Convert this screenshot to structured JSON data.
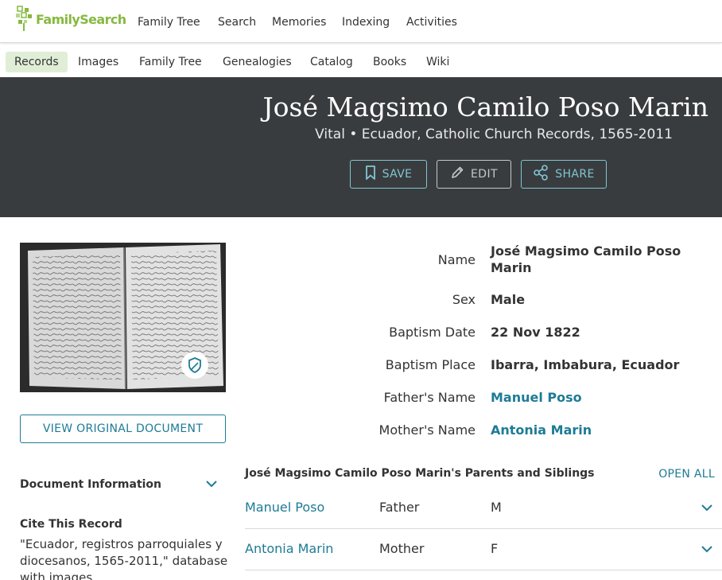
{
  "brand": {
    "name": "FamilySearch",
    "accent": "#87b940",
    "link_color": "#1e7b96"
  },
  "topnav": [
    "Family Tree",
    "Search",
    "Memories",
    "Indexing",
    "Activities"
  ],
  "subnav": {
    "active": "Records",
    "items": [
      "Records",
      "Images",
      "Family Tree",
      "Genealogies",
      "Catalog",
      "Books",
      "Wiki"
    ]
  },
  "banner": {
    "title": "José Magsimo Camilo Poso Marin",
    "subtitle": "Vital • Ecuador, Catholic Church Records, 1565-2011",
    "buttons": {
      "save": "SAVE",
      "edit": "EDIT",
      "share": "SHARE"
    }
  },
  "left": {
    "view_button": "VIEW ORIGINAL DOCUMENT",
    "document_info": "Document Information",
    "cite_title": "Cite This Record",
    "cite_text": "\"Ecuador, registros parroquiales y diocesanos, 1565-2011,\" database with images"
  },
  "facts": [
    {
      "label": "Name",
      "value": "José Magsimo Camilo Poso Marin",
      "link": false
    },
    {
      "label": "Sex",
      "value": "Male",
      "link": false
    },
    {
      "label": "Baptism Date",
      "value": "22 Nov 1822",
      "link": false
    },
    {
      "label": "Baptism Place",
      "value": "Ibarra, Imbabura, Ecuador",
      "link": false
    },
    {
      "label": "Father's Name",
      "value": "Manuel Poso",
      "link": true
    },
    {
      "label": "Mother's Name",
      "value": "Antonia Marin",
      "link": true
    }
  ],
  "parents_siblings": {
    "heading": "José Magsimo Camilo Poso Marin's Parents and Siblings",
    "open_all": "OPEN ALL",
    "rows": [
      {
        "name": "Manuel Poso",
        "relationship": "Father",
        "sex": "M"
      },
      {
        "name": "Antonia Marin",
        "relationship": "Mother",
        "sex": "F"
      }
    ]
  }
}
